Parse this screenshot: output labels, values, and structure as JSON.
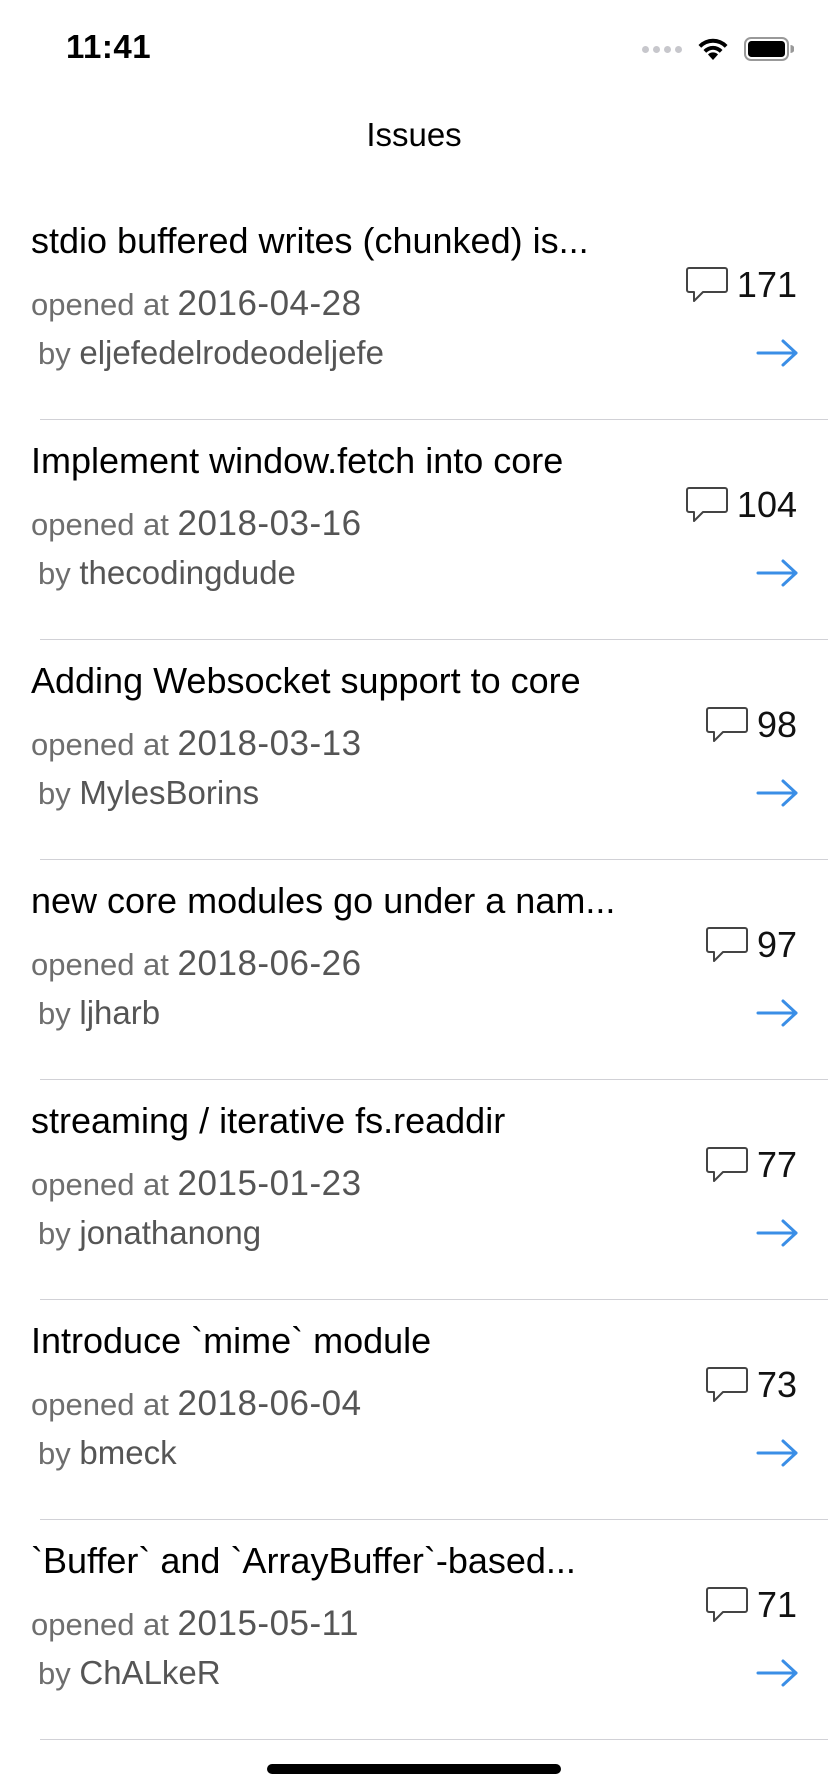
{
  "status_bar": {
    "time": "11:41"
  },
  "nav": {
    "title": "Issues"
  },
  "labels": {
    "opened_at": "opened at",
    "by": "by"
  },
  "issues": [
    {
      "title": "stdio buffered writes (chunked) is...",
      "date": "2016-04-28",
      "author": "eljefedelrodeodeljefe",
      "comments": "171"
    },
    {
      "title": "Implement window.fetch into core",
      "date": "2018-03-16",
      "author": "thecodingdude",
      "comments": "104"
    },
    {
      "title": "Adding Websocket support to core",
      "date": "2018-03-13",
      "author": "MylesBorins",
      "comments": "98"
    },
    {
      "title": "new core modules go under a nam...",
      "date": "2018-06-26",
      "author": "ljharb",
      "comments": "97"
    },
    {
      "title": "streaming / iterative fs.readdir",
      "date": "2015-01-23",
      "author": "jonathanong",
      "comments": "77"
    },
    {
      "title": "Introduce `mime` module",
      "date": "2018-06-04",
      "author": "bmeck",
      "comments": "73"
    },
    {
      "title": "`Buffer` and `ArrayBuffer`-based...",
      "date": "2015-05-11",
      "author": "ChALkeR",
      "comments": "71"
    }
  ],
  "colors": {
    "accent": "#3a8ee6",
    "separator": "#d1d1d6",
    "secondary_text": "#6e6e6e"
  },
  "icons": {
    "comment": "speech-bubble-icon",
    "arrow": "arrow-right-icon",
    "wifi": "wifi-icon",
    "battery": "battery-icon"
  }
}
